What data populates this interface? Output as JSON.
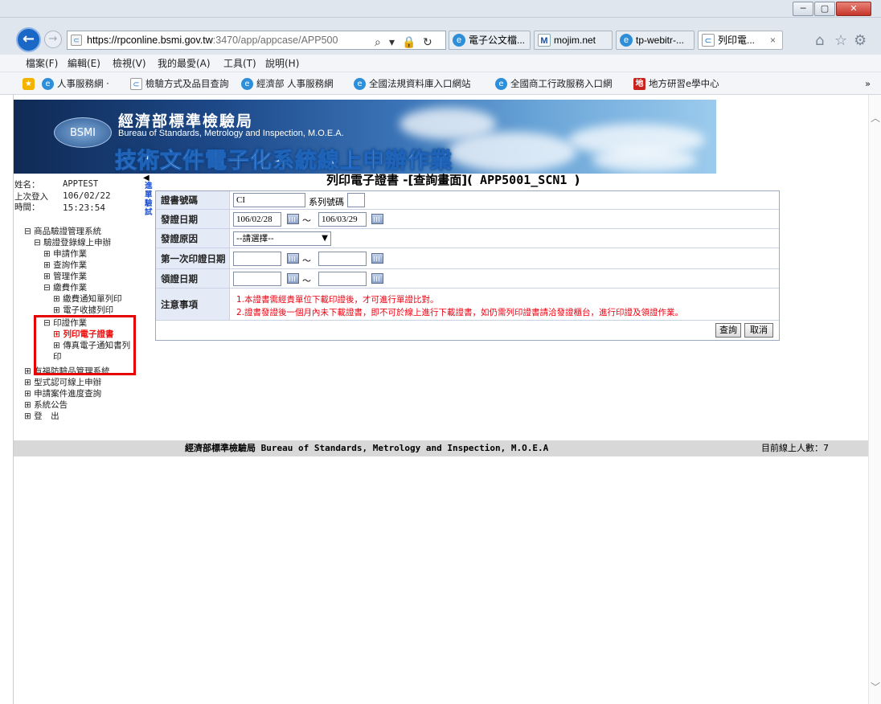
{
  "window": {
    "min": "─",
    "max": "▢",
    "close": "✕"
  },
  "browser": {
    "url_main": "https://rpconline.bsmi.gov.tw",
    "url_rest": ":3470/app/appcase/APP500",
    "tabs": [
      {
        "label": "電子公文檔...",
        "icon": "ie"
      },
      {
        "label": "mojim.net",
        "icon": "m"
      },
      {
        "label": "tp-webitr-...",
        "icon": "ie"
      },
      {
        "label": "列印電...",
        "icon": "doc",
        "close": "×"
      }
    ]
  },
  "menu": [
    "檔案(F)",
    "編輯(E)",
    "檢視(V)",
    "我的最愛(A)",
    "工具(T)",
    "說明(H)"
  ],
  "favorites": [
    "人事服務網 ·",
    "檢驗方式及品目查詢",
    "經濟部 人事服務網",
    "全國法規資料庫入口網站",
    "全國商工行政服務入口網",
    "地方研習e學中心"
  ],
  "banner": {
    "logo": "BSMI",
    "title": "經濟部標準檢驗局",
    "subtitle": "Bureau of Standards, Metrology and Inspection, M.O.E.A.",
    "system": "技術文件電子化系統線上申辦作業"
  },
  "user": {
    "name_label": "姓名：",
    "name": "APPTEST",
    "last_login_label": "上次登入",
    "date": "106/02/22",
    "time_label": "時間：",
    "time": "15:23:54"
  },
  "collapse_label": "進單驗試",
  "tree": {
    "root": "⊟ 商品驗證管理系統",
    "reg": "⊟ 驗證登錄線上申辦",
    "apply": "⊞ 申請作業",
    "query": "⊞ 查詢作業",
    "manage": "⊞ 管理作業",
    "fee": "⊟ 繳費作業",
    "fee_notice": "⊞ 繳費通知單列印",
    "e_receipt": "⊞ 電子收據列印",
    "print": "⊟ 印證作業",
    "print_cert": "⊞ 列印電子證書",
    "fax_notice": "⊞ 傳真電子通知書列",
    "fax_notice2": "印",
    "sensitive": "⊞ 有福防驗品管理系統",
    "type": "⊞ 型式認可線上申辦",
    "progress": "⊞ 申請案件進度查詢",
    "announce": "⊞ 系統公告",
    "logout": "⊞ 登　出"
  },
  "form": {
    "title_prefix": "列印電子證書 -[查詢畫面](",
    "title_code": " APP5001_SCN1 ",
    "title_suffix": ")",
    "cert_no_label": "證書號碼",
    "cert_no_value": "CI",
    "serial_label": "系列號碼",
    "issue_label": "發證日期",
    "issue_from": "106/02/28",
    "issue_to": "106/03/29",
    "reason_label": "發證原因",
    "reason_value": "--請選擇--",
    "first_print_label": "第一次印證日期",
    "receive_label": "領證日期",
    "notice_label": "注意事項",
    "note1": "1.本證書需經貴單位下載印證後，才可進行單證比對。",
    "note2": "2.證書發證後一個月內未下載證書，即不可於線上進行下載證書，如仍需列印證書請洽發證櫃台，進行印證及領證作業。",
    "query_btn": "查詢",
    "cancel_btn": "取消",
    "tilde": "～"
  },
  "footer": {
    "org_cn": "經濟部標準檢驗局",
    "org_en": " Bureau of Standards, Metrology and Inspection, M.O.E.A",
    "online": "目前線上人數：7"
  }
}
